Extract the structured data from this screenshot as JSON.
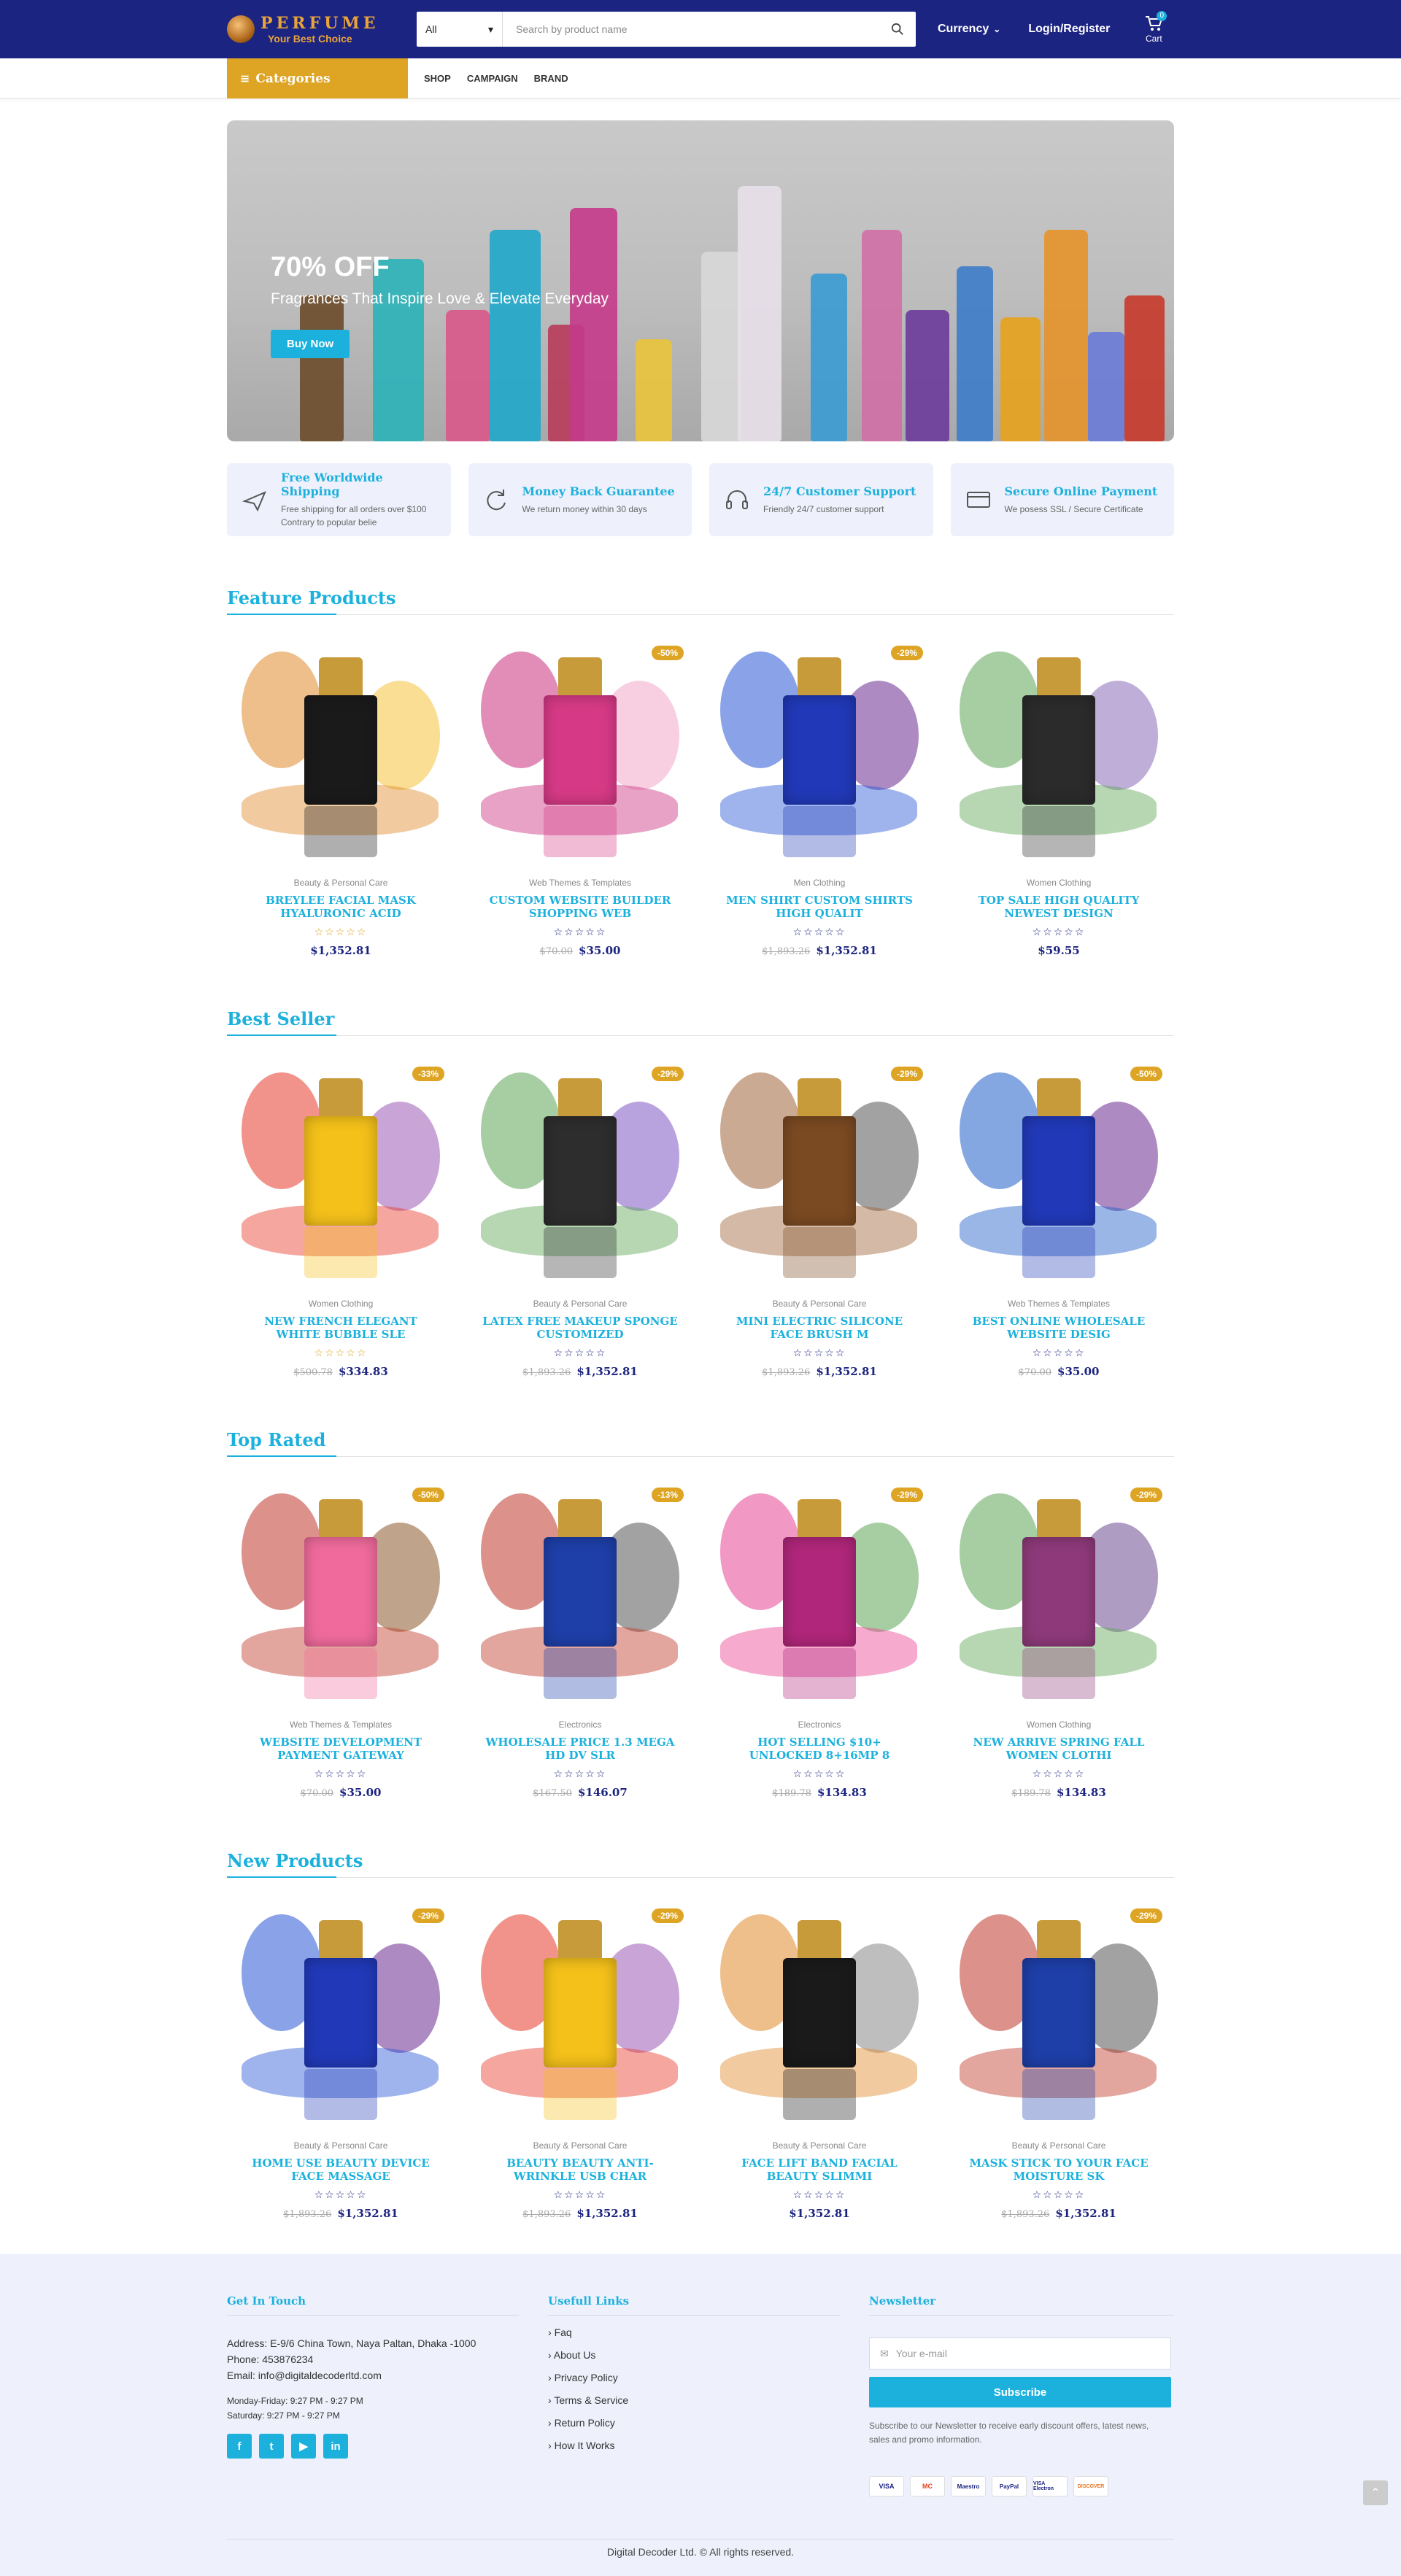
{
  "header": {
    "logo_title": "PERFUME",
    "logo_sub": "Your Best Choice",
    "search_select": "All",
    "search_placeholder": "Search by product name",
    "currency_label": "Currency",
    "login_label": "Login/Register",
    "cart_label": "Cart",
    "cart_count": "0"
  },
  "nav": {
    "categories_label": "Categories",
    "links": [
      "SHOP",
      "CAMPAIGN",
      "BRAND"
    ]
  },
  "hero": {
    "title": "70% OFF",
    "subtitle": "Fragrances That Inspire Love & Elevate Everyday",
    "button": "Buy Now"
  },
  "features": [
    {
      "icon": "plane-icon",
      "title": "Free Worldwide Shipping",
      "desc": "Free shipping for all orders over $100 Contrary to popular belie"
    },
    {
      "icon": "refresh-icon",
      "title": "Money Back Guarantee",
      "desc": "We return money within 30 days"
    },
    {
      "icon": "headset-icon",
      "title": "24/7 Customer Support",
      "desc": "Friendly 24/7 customer support"
    },
    {
      "icon": "credit-card-icon",
      "title": "Secure Online Payment",
      "desc": "We posess SSL / Secure Certificate"
    }
  ],
  "stars": "☆☆☆☆☆",
  "sections": [
    {
      "title": "Feature Products",
      "products": [
        {
          "discount": "",
          "category": "Beauty & Personal Care",
          "name": "BREYLEE FACIAL MASK HYALURONIC ACID",
          "old_price": "",
          "price": "$1,352.81",
          "colors": [
            "#1a1a1a",
            "#e08a2a",
            "#f5c23a"
          ],
          "gold_stars": true
        },
        {
          "discount": "-50%",
          "category": "Web Themes & Templates",
          "name": "CUSTOM WEBSITE BUILDER SHOPPING WEB",
          "old_price": "$70.00",
          "price": "$35.00",
          "colors": [
            "#d63a86",
            "#c9307e",
            "#f1a7c9"
          ],
          "gold_stars": false
        },
        {
          "discount": "-29%",
          "category": "Men Clothing",
          "name": "MEN SHIRT CUSTOM SHIRTS HIGH QUALIT",
          "old_price": "$1,893.26",
          "price": "$1,352.81",
          "colors": [
            "#2139b8",
            "#2a58d6",
            "#6a2c8f"
          ],
          "gold_stars": false
        },
        {
          "discount": "",
          "category": "Women Clothing",
          "name": "TOP SALE HIGH QUALITY NEWEST DESIGN",
          "old_price": "",
          "price": "$59.55",
          "colors": [
            "#2b2b2b",
            "#5fa657",
            "#8b6bb8"
          ],
          "gold_stars": false
        }
      ]
    },
    {
      "title": "Best Seller",
      "products": [
        {
          "discount": "-33%",
          "category": "Women Clothing",
          "name": "NEW FRENCH ELEGANT WHITE BUBBLE SLE",
          "old_price": "$500.78",
          "price": "$334.83",
          "colors": [
            "#f4c11a",
            "#e63a2a",
            "#9b59b6"
          ],
          "gold_stars": true
        },
        {
          "discount": "-29%",
          "category": "Beauty & Personal Care",
          "name": "LATEX FREE MAKEUP SPONGE CUSTOMIZED",
          "old_price": "$1,893.26",
          "price": "$1,352.81",
          "colors": [
            "#2d2d2d",
            "#5fa657",
            "#7e57c2"
          ],
          "gold_stars": false
        },
        {
          "discount": "-29%",
          "category": "Beauty & Personal Care",
          "name": "MINI ELECTRIC SILICONE FACE BRUSH M",
          "old_price": "$1,893.26",
          "price": "$1,352.81",
          "colors": [
            "#7a4a22",
            "#a0653a",
            "#555555"
          ],
          "gold_stars": false
        },
        {
          "discount": "-50%",
          "category": "Web Themes & Templates",
          "name": "BEST ONLINE WHOLESALE WEBSITE DESIG",
          "old_price": "$70.00",
          "price": "$35.00",
          "colors": [
            "#2139b8",
            "#1f5ec8",
            "#6a2c8f"
          ],
          "gold_stars": false
        }
      ]
    },
    {
      "title": "Top Rated",
      "products": [
        {
          "discount": "-50%",
          "category": "Web Themes & Templates",
          "name": "WEBSITE DEVELOPMENT PAYMENT GATEWAY",
          "old_price": "$70.00",
          "price": "$35.00",
          "colors": [
            "#f06b9c",
            "#c0392b",
            "#8b5a2b"
          ],
          "gold_stars": false
        },
        {
          "discount": "-13%",
          "category": "Electronics",
          "name": "WHOLESALE PRICE 1.3 MEGA HD DV SLR",
          "old_price": "$167.50",
          "price": "$146.07",
          "colors": [
            "#1e3fa8",
            "#c0392b",
            "#555555"
          ],
          "gold_stars": false
        },
        {
          "discount": "-29%",
          "category": "Electronics",
          "name": "HOT SELLING $10+ UNLOCKED 8+16MP 8",
          "old_price": "$189.78",
          "price": "$134.83",
          "colors": [
            "#b0267a",
            "#e84393",
            "#5fa657"
          ],
          "gold_stars": false
        },
        {
          "discount": "-29%",
          "category": "Women Clothing",
          "name": "NEW ARRIVE SPRING FALL WOMEN CLOTHI",
          "old_price": "$189.78",
          "price": "$134.83",
          "colors": [
            "#8e3a7a",
            "#5fa657",
            "#6b4a8f"
          ],
          "gold_stars": false
        }
      ]
    },
    {
      "title": "New Products",
      "products": [
        {
          "discount": "-29%",
          "category": "Beauty & Personal Care",
          "name": "HOME USE BEAUTY DEVICE FACE MASSAGE",
          "old_price": "$1,893.26",
          "price": "$1,352.81",
          "colors": [
            "#2139b8",
            "#2a58d6",
            "#6a2c8f"
          ],
          "gold_stars": false
        },
        {
          "discount": "-29%",
          "category": "Beauty & Personal Care",
          "name": "BEAUTY BEAUTY ANTI-WRINKLE USB CHAR",
          "old_price": "$1,893.26",
          "price": "$1,352.81",
          "colors": [
            "#f4c11a",
            "#e63a2a",
            "#9b59b6"
          ],
          "gold_stars": false
        },
        {
          "discount": "",
          "category": "Beauty & Personal Care",
          "name": "FACE LIFT BAND FACIAL BEAUTY SLIMMI",
          "old_price": "",
          "price": "$1,352.81",
          "colors": [
            "#1a1a1a",
            "#e08a2a",
            "#888888"
          ],
          "gold_stars": false
        },
        {
          "discount": "-29%",
          "category": "Beauty & Personal Care",
          "name": "MASK STICK TO YOUR FACE MOISTURE SK",
          "old_price": "$1,893.26",
          "price": "$1,352.81",
          "colors": [
            "#1e3fa8",
            "#c0392b",
            "#555555"
          ],
          "gold_stars": false
        }
      ]
    }
  ],
  "footer": {
    "contact_heading": "Get In Touch",
    "address": "Address: E-9/6 China Town, Naya Paltan, Dhaka -1000",
    "phone": "Phone: 453876234",
    "email": "Email: info@digitaldecoderltd.com",
    "hours1": "Monday-Friday: 9:27 PM - 9:27 PM",
    "hours2": "Saturday: 9:27 PM - 9:27 PM",
    "social": [
      "f",
      "t",
      "▶",
      "in"
    ],
    "links_heading": "Usefull Links",
    "links": [
      "Faq",
      "About Us",
      "Privacy Policy",
      "Terms & Service",
      "Return Policy",
      "How It Works"
    ],
    "newsletter_heading": "Newsletter",
    "email_placeholder": "Your e-mail",
    "subscribe": "Subscribe",
    "newsletter_text": "Subscribe to our Newsletter to receive early discount offers, latest news, sales and promo information.",
    "payments": [
      "VISA",
      "MC",
      "Maestro",
      "PayPal",
      "VISA Electron",
      "DISCOVER"
    ],
    "copyright": "Digital Decoder Ltd. © All rights reserved."
  },
  "colors": {
    "navy": "#1c2481",
    "accent": "#1cb1dd",
    "gold": "#dea423"
  }
}
